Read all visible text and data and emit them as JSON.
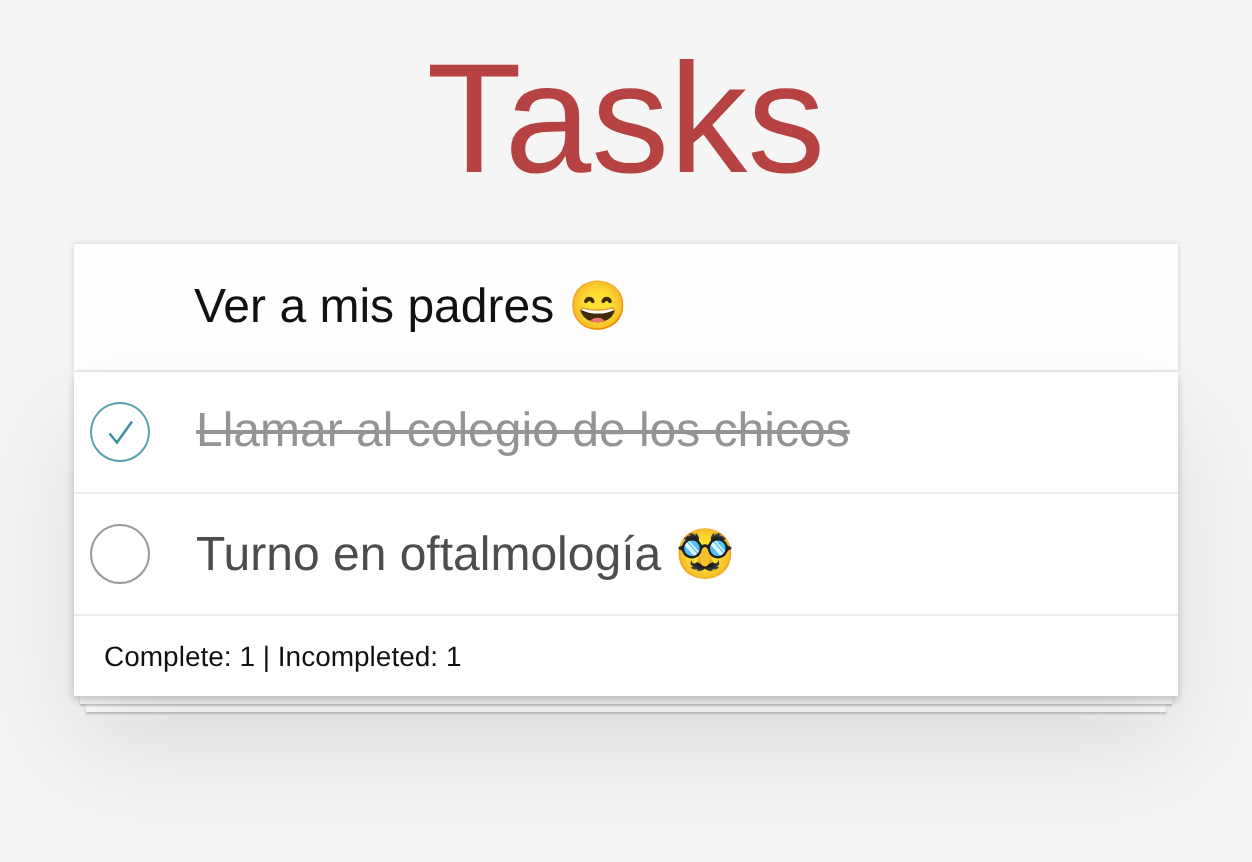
{
  "title": "Tasks",
  "new_task": {
    "value": "Ver a mis padres 😄"
  },
  "tasks": [
    {
      "label": "Llamar al colegio de los chicos",
      "checked": true
    },
    {
      "label": "Turno en oftalmología 🥸",
      "checked": false
    }
  ],
  "footer": {
    "counter": "Complete: 1 | Incompleted: 1"
  }
}
